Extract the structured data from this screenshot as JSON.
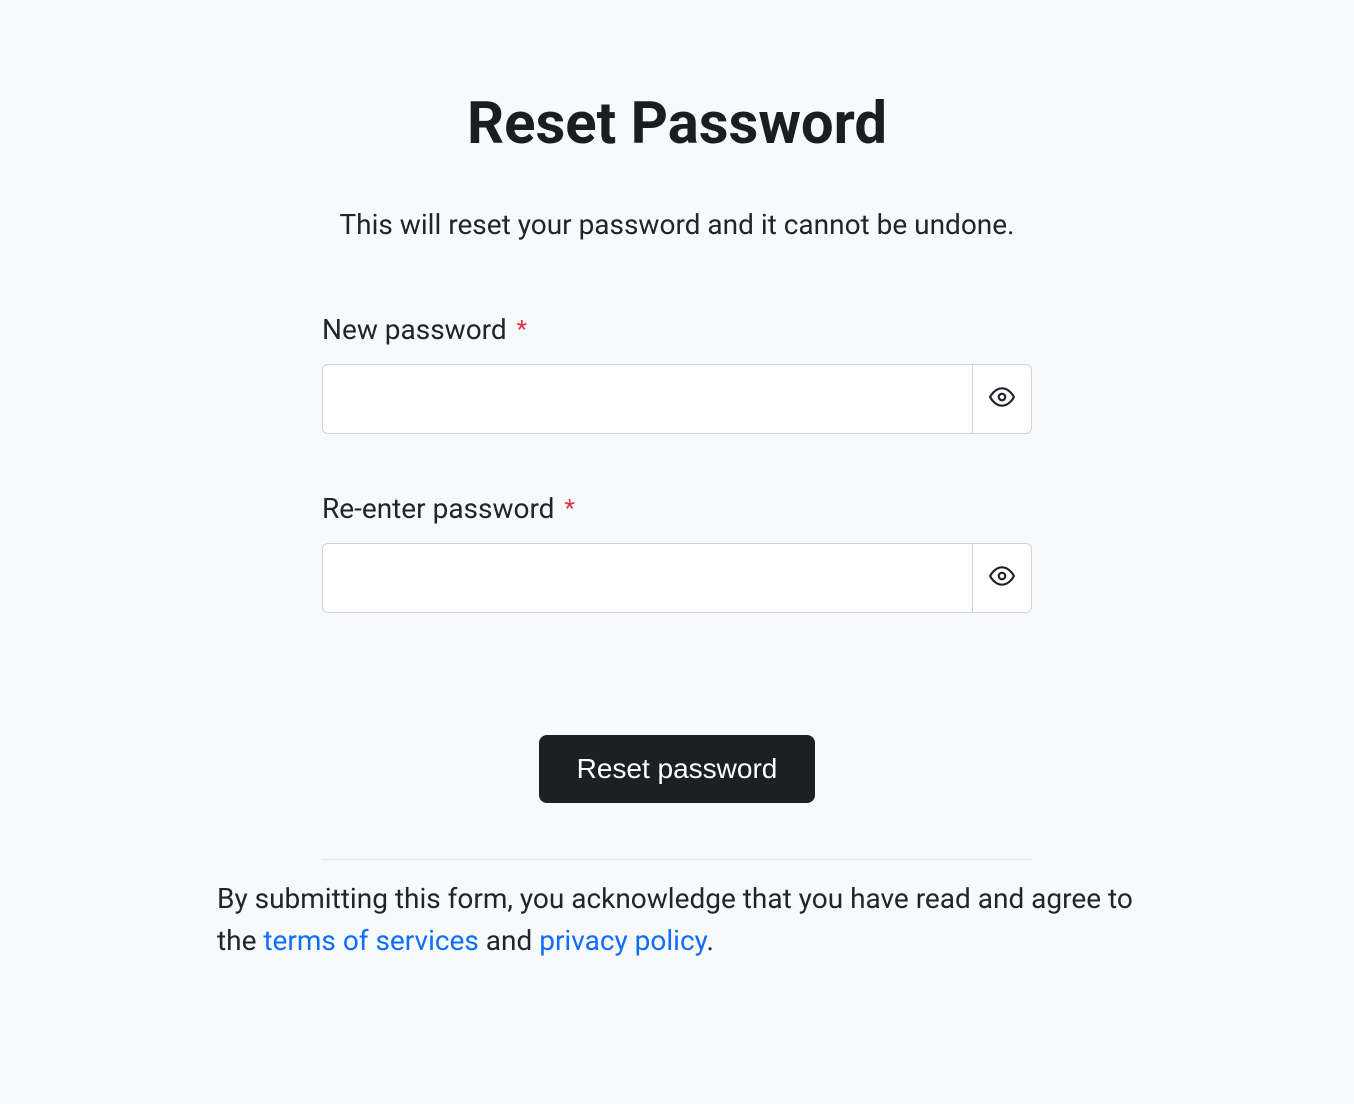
{
  "heading": "Reset Password",
  "subtitle": "This will reset your password and it cannot be undone.",
  "fields": {
    "new_password": {
      "label": "New password",
      "value": ""
    },
    "reenter_password": {
      "label": "Re-enter password",
      "value": ""
    }
  },
  "required_marker": "*",
  "submit_label": "Reset password",
  "footer": {
    "prefix": "By submitting this form, you acknowledge that you have read and agree to the ",
    "terms_link": "terms of services",
    "middle": " and ",
    "privacy_link": "privacy policy",
    "suffix": "."
  }
}
